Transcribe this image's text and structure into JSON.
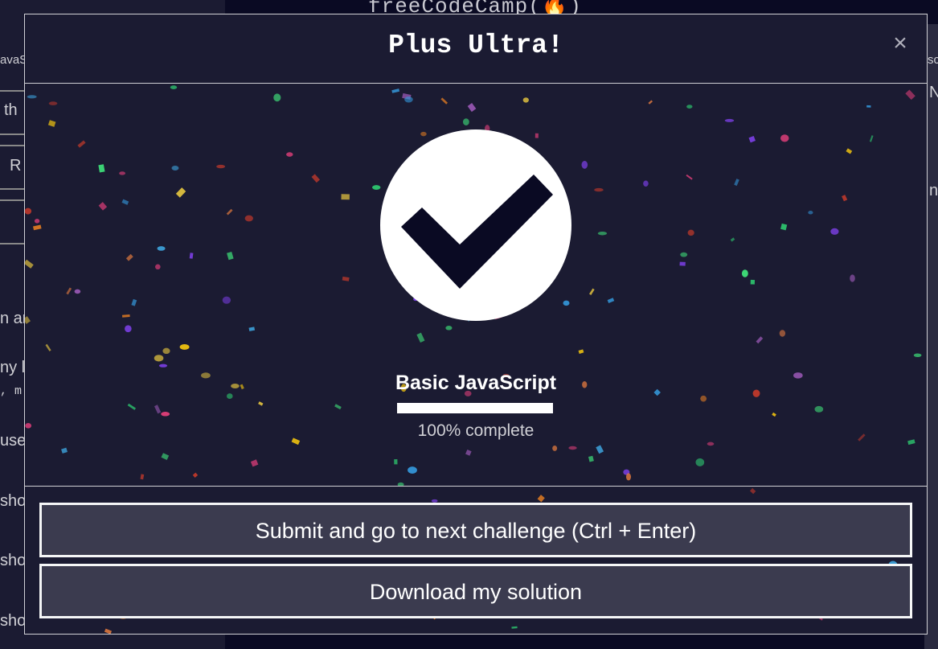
{
  "background": {
    "logo_text": "freeCodeCamp(🔥)",
    "fragments": [
      "avaS",
      "th",
      "R",
      "n ar",
      "ny l",
      ", m",
      "use",
      "sho",
      "sho",
      "sho",
      "sc",
      "N",
      "n"
    ]
  },
  "modal": {
    "title": "Plus Ultra!",
    "close_label": "×",
    "close_icon": "close-icon",
    "success_icon": "checkmark-icon",
    "block_title": "Basic JavaScript",
    "progress": {
      "percent": 100,
      "label": "100% complete"
    },
    "buttons": {
      "submit_label": "Submit and go to next challenge (Ctrl + Enter)",
      "download_label": "Download my solution"
    }
  },
  "colors": {
    "modal_bg": "#1b1b32",
    "page_bg": "#0a0a23",
    "button_bg": "#3b3b4f",
    "check_fg": "#0a0a23",
    "confetti": [
      "#7b3fe4",
      "#e43f7b",
      "#3fa9e4",
      "#e4c43f",
      "#3fe47b",
      "#e47b3f",
      "#9b59b6",
      "#2ecc71",
      "#f1c40f",
      "#3498db",
      "#e67e22",
      "#c0392b"
    ]
  }
}
